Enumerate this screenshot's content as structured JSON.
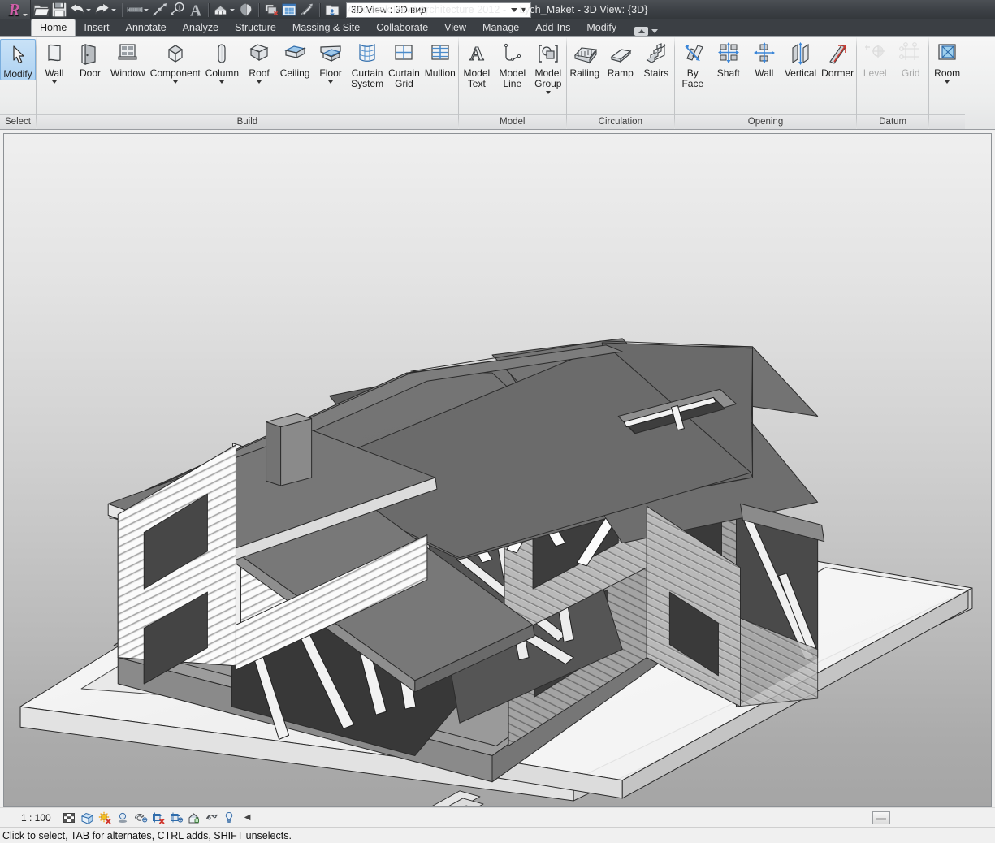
{
  "window": {
    "app_title": "Autodesk Revit Architecture 2012 -",
    "document_title": "Lych_Maket - 3D View: {3D}",
    "logo_glyph": "R"
  },
  "quick_access": {
    "items": [
      {
        "name": "open-icon",
        "tooltip": "Open",
        "caret": false
      },
      {
        "name": "save-icon",
        "tooltip": "Save",
        "caret": false
      },
      {
        "name": "undo-icon",
        "tooltip": "Undo",
        "caret": true
      },
      {
        "name": "redo-icon",
        "tooltip": "Redo",
        "caret": true
      },
      {
        "name": "measure-icon",
        "tooltip": "Measure",
        "caret": true
      },
      {
        "name": "aligned-dimension-icon",
        "tooltip": "Aligned Dimension",
        "caret": false
      },
      {
        "name": "tag-by-category-icon",
        "tooltip": "Tag by Category",
        "caret": false
      },
      {
        "name": "text-icon",
        "tooltip": "Text",
        "caret": false
      },
      {
        "name": "default-3d-view-icon",
        "tooltip": "Default 3D View",
        "caret": true
      },
      {
        "name": "section-icon",
        "tooltip": "Section",
        "caret": false
      },
      {
        "name": "thin-lines-icon",
        "tooltip": "Thin Lines",
        "caret": false
      },
      {
        "name": "close-hidden-windows-icon",
        "tooltip": "Close Hidden Windows",
        "caret": false
      },
      {
        "name": "switch-windows-icon",
        "tooltip": "Switch Windows",
        "caret": false
      },
      {
        "name": "customize-qat-icon",
        "tooltip": "Customize Quick Access Toolbar",
        "caret": false
      }
    ],
    "view_selector_value": "3D View : 3D вид"
  },
  "ribbon_tabs": [
    {
      "label": "Home",
      "active": true
    },
    {
      "label": "Insert",
      "active": false
    },
    {
      "label": "Annotate",
      "active": false
    },
    {
      "label": "Analyze",
      "active": false
    },
    {
      "label": "Structure",
      "active": false
    },
    {
      "label": "Massing & Site",
      "active": false
    },
    {
      "label": "Collaborate",
      "active": false
    },
    {
      "label": "View",
      "active": false
    },
    {
      "label": "Manage",
      "active": false
    },
    {
      "label": "Add-Ins",
      "active": false
    },
    {
      "label": "Modify",
      "active": false
    }
  ],
  "ribbon_panels": [
    {
      "title": "Select",
      "buttons": [
        {
          "label": "Modify",
          "icon": "cursor-arrow-icon",
          "dropdown": false,
          "selected": true,
          "disabled": false
        }
      ]
    },
    {
      "title": "Build",
      "buttons": [
        {
          "label": "Wall",
          "icon": "wall-icon",
          "dropdown": true,
          "selected": false,
          "disabled": false
        },
        {
          "label": "Door",
          "icon": "door-icon",
          "dropdown": false,
          "selected": false,
          "disabled": false
        },
        {
          "label": "Window",
          "icon": "window-icon",
          "dropdown": false,
          "selected": false,
          "disabled": false
        },
        {
          "label": "Component",
          "icon": "component-icon",
          "dropdown": true,
          "selected": false,
          "disabled": false
        },
        {
          "label": "Column",
          "icon": "column-icon",
          "dropdown": true,
          "selected": false,
          "disabled": false
        },
        {
          "label": "Roof",
          "icon": "roof-icon",
          "dropdown": true,
          "selected": false,
          "disabled": false
        },
        {
          "label": "Ceiling",
          "icon": "ceiling-icon",
          "dropdown": false,
          "selected": false,
          "disabled": false
        },
        {
          "label": "Floor",
          "icon": "floor-icon",
          "dropdown": true,
          "selected": false,
          "disabled": false
        },
        {
          "label": "Curtain\nSystem",
          "icon": "curtain-system-icon",
          "dropdown": false,
          "selected": false,
          "disabled": false
        },
        {
          "label": "Curtain\nGrid",
          "icon": "curtain-grid-icon",
          "dropdown": false,
          "selected": false,
          "disabled": false
        },
        {
          "label": "Mullion",
          "icon": "mullion-icon",
          "dropdown": false,
          "selected": false,
          "disabled": false
        }
      ]
    },
    {
      "title": "Model",
      "buttons": [
        {
          "label": "Model\nText",
          "icon": "model-text-icon",
          "dropdown": false,
          "selected": false,
          "disabled": false
        },
        {
          "label": "Model\nLine",
          "icon": "model-line-icon",
          "dropdown": false,
          "selected": false,
          "disabled": false
        },
        {
          "label": "Model\nGroup",
          "icon": "model-group-icon",
          "dropdown": true,
          "selected": false,
          "disabled": false
        }
      ]
    },
    {
      "title": "Circulation",
      "buttons": [
        {
          "label": "Railing",
          "icon": "railing-icon",
          "dropdown": false,
          "selected": false,
          "disabled": false
        },
        {
          "label": "Ramp",
          "icon": "ramp-icon",
          "dropdown": false,
          "selected": false,
          "disabled": false
        },
        {
          "label": "Stairs",
          "icon": "stairs-icon",
          "dropdown": false,
          "selected": false,
          "disabled": false
        }
      ]
    },
    {
      "title": "Opening",
      "buttons": [
        {
          "label": "By\nFace",
          "icon": "opening-by-face-icon",
          "dropdown": false,
          "selected": false,
          "disabled": false
        },
        {
          "label": "Shaft",
          "icon": "shaft-opening-icon",
          "dropdown": false,
          "selected": false,
          "disabled": false
        },
        {
          "label": "Wall",
          "icon": "wall-opening-icon",
          "dropdown": false,
          "selected": false,
          "disabled": false
        },
        {
          "label": "Vertical",
          "icon": "vertical-opening-icon",
          "dropdown": false,
          "selected": false,
          "disabled": false
        },
        {
          "label": "Dormer",
          "icon": "dormer-opening-icon",
          "dropdown": false,
          "selected": false,
          "disabled": false
        }
      ]
    },
    {
      "title": "Datum",
      "buttons": [
        {
          "label": "Level",
          "icon": "level-icon",
          "dropdown": false,
          "selected": false,
          "disabled": true
        },
        {
          "label": "Grid",
          "icon": "grid-icon",
          "dropdown": false,
          "selected": false,
          "disabled": true
        }
      ]
    },
    {
      "title": "",
      "buttons": [
        {
          "label": "Room",
          "icon": "room-icon",
          "dropdown": true,
          "selected": false,
          "disabled": false
        }
      ]
    }
  ],
  "view_control_bar": {
    "scale": "1 : 100",
    "icons": [
      {
        "name": "detail-level-icon",
        "tooltip": "Detail Level"
      },
      {
        "name": "visual-style-icon",
        "tooltip": "Visual Style"
      },
      {
        "name": "sun-path-off-icon",
        "tooltip": "Sun Path Off"
      },
      {
        "name": "shadows-off-icon",
        "tooltip": "Shadows Off"
      },
      {
        "name": "render-dialog-icon",
        "tooltip": "Show Rendering Dialog"
      },
      {
        "name": "crop-region-off-icon",
        "tooltip": "Crop Region Off"
      },
      {
        "name": "show-crop-region-icon",
        "tooltip": "Show Crop Region"
      },
      {
        "name": "temporary-hide-isolate-icon",
        "tooltip": "Temporary Hide/Isolate"
      },
      {
        "name": "reveal-hidden-elements-icon",
        "tooltip": "Reveal Hidden Elements"
      },
      {
        "name": "worksharing-display-icon",
        "tooltip": "Worksharing Display"
      }
    ],
    "expand_arrow": "◀"
  },
  "status_bar": {
    "message": "Click to select, TAB for alternates, CTRL adds, SHIFT unselects."
  },
  "canvas": {
    "name": "3d-view-canvas",
    "description": "Shaded 3D isometric view of a two-storey log house with exposed roof trusses on a site pad"
  },
  "colors": {
    "titlebar_dark": "#3d4146",
    "ribbon_light": "#f0f0f0",
    "tab_active_bg": "#f0f0f0",
    "select_highlight": "#aed2f2",
    "accent_blue": "#3b7fc4",
    "logo_pink": "#cf5fa8",
    "canvas_top": "#efefef",
    "canvas_bottom": "#a5a5a5"
  }
}
